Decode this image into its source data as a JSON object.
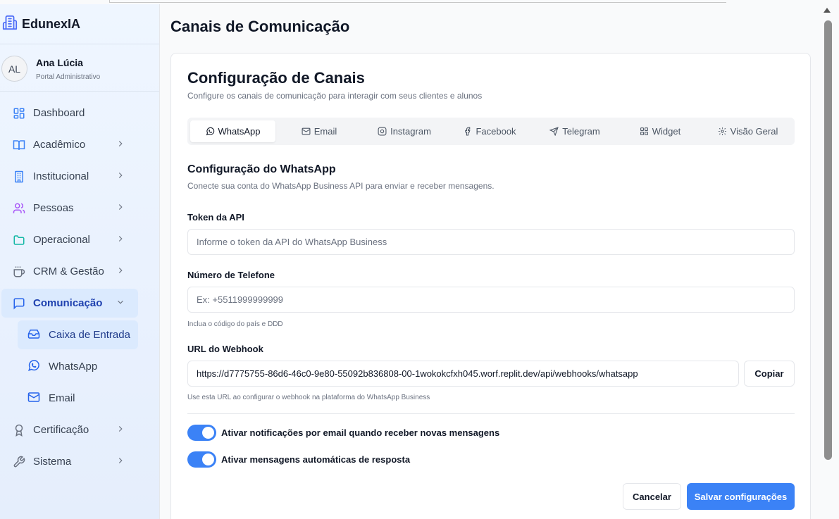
{
  "app": {
    "name": "EdunexIA"
  },
  "user": {
    "initials": "AL",
    "name": "Ana Lúcia",
    "role": "Portal Administrativo"
  },
  "nav": {
    "dashboard": "Dashboard",
    "academico": "Acadêmico",
    "institucional": "Institucional",
    "pessoas": "Pessoas",
    "operacional": "Operacional",
    "crm": "CRM & Gestão",
    "comunicacao": "Comunicação",
    "caixa_entrada": "Caixa de Entrada",
    "whatsapp": "WhatsApp",
    "email": "Email",
    "certificacao": "Certificação",
    "sistema": "Sistema"
  },
  "page": {
    "title": "Canais de Comunicação"
  },
  "card": {
    "title": "Configuração de Canais",
    "subtitle": "Configure os canais de comunicação para interagir com seus clientes e alunos"
  },
  "tabs": {
    "whatsapp": "WhatsApp",
    "email": "Email",
    "instagram": "Instagram",
    "facebook": "Facebook",
    "telegram": "Telegram",
    "widget": "Widget",
    "visao_geral": "Visão Geral"
  },
  "section": {
    "title": "Configuração do WhatsApp",
    "subtitle": "Conecte sua conta do WhatsApp Business API para enviar e receber mensagens."
  },
  "form": {
    "token_label": "Token da API",
    "token_placeholder": "Informe o token da API do WhatsApp Business",
    "phone_label": "Número de Telefone",
    "phone_placeholder": "Ex: +5511999999999",
    "phone_hint": "Inclua o código do país e DDD",
    "webhook_label": "URL do Webhook",
    "webhook_value": "https://d7775755-86d6-46c0-9e80-55092b836808-00-1wokokcfxh045.worf.replit.dev/api/webhooks/whatsapp",
    "copy_label": "Copiar",
    "webhook_hint": "Use esta URL ao configurar o webhook na plataforma do WhatsApp Business"
  },
  "toggles": {
    "email_notifications": {
      "label": "Ativar notificações por email quando receber novas mensagens",
      "on": true
    },
    "auto_reply": {
      "label": "Ativar mensagens automáticas de resposta",
      "on": true
    }
  },
  "actions": {
    "cancel": "Cancelar",
    "save": "Salvar configurações"
  },
  "colors": {
    "accent": "#3b82f6",
    "active_nav_bg": "#dbeafe",
    "active_nav_text": "#1e40af"
  }
}
